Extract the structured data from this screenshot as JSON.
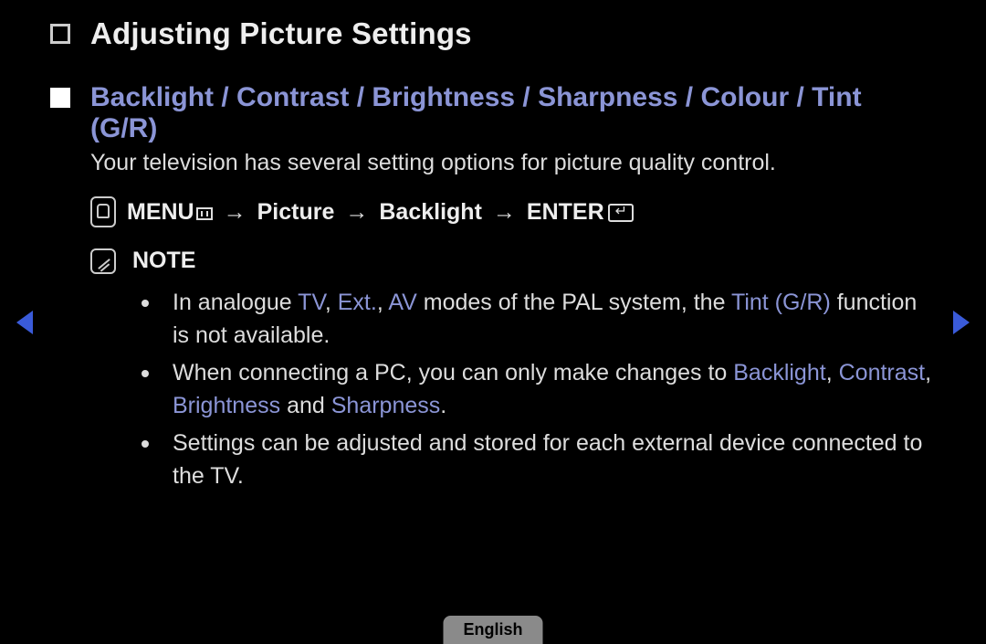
{
  "title": "Adjusting Picture Settings",
  "section": {
    "heading": "Backlight / Contrast / Brightness / Sharpness / Colour / Tint (G/R)",
    "subtitle": "Your television has several setting options for picture quality control."
  },
  "path": {
    "menu": "MENU",
    "step1": "Picture",
    "step2": "Backlight",
    "enter": "ENTER",
    "arrow": "→"
  },
  "note_label": "NOTE",
  "notes": {
    "n1": {
      "pre": "In analogue ",
      "tv": "TV",
      "c1": ", ",
      "ext": "Ext.",
      "c2": ", ",
      "av": "AV",
      "mid": " modes of the PAL system, the ",
      "tint": "Tint (G/R)",
      "post": " function is not available."
    },
    "n2": {
      "pre": "When connecting a PC, you can only make changes to ",
      "backlight": "Backlight",
      "c1": ", ",
      "contrast": "Contrast",
      "c2": ", ",
      "brightness": "Brightness",
      "and": " and ",
      "sharpness": "Sharpness",
      "post": "."
    },
    "n3": "Settings can be adjusted and stored for each external device connected to the TV."
  },
  "language": "English"
}
